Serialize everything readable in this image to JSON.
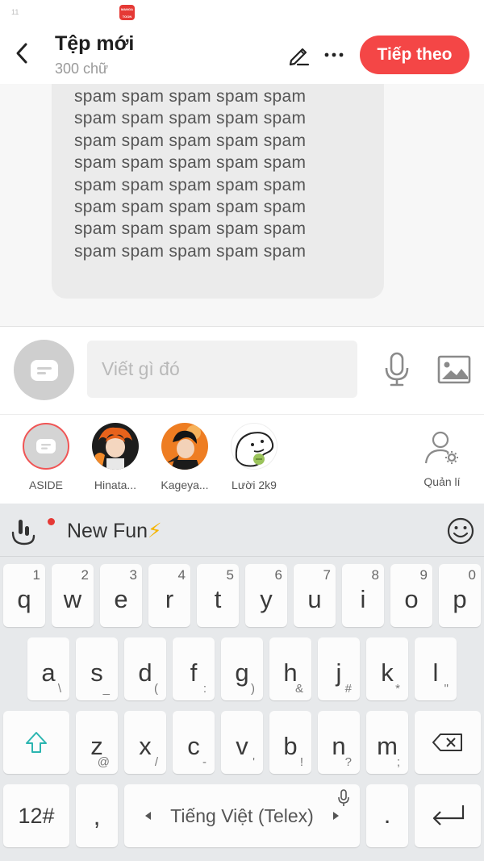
{
  "status_bar": {
    "left_text": "11",
    "app_logo_text": "MANGA TOON"
  },
  "header": {
    "title": "Tệp mới",
    "subtitle": "300 chữ",
    "next_button": "Tiếp theo"
  },
  "message": {
    "text": "spam spam spam spam spam spam spam spam spam spam spam spam spam spam spam spam spam spam spam spam spam spam spam spam spam spam spam spam spam spam spam spam spam spam spam spam spam spam spam spam"
  },
  "compose": {
    "placeholder": "Viết gì đó"
  },
  "characters": [
    {
      "name": "ASIDE"
    },
    {
      "name": "Hinata..."
    },
    {
      "name": "Kageya..."
    },
    {
      "name": "Lười 2k9"
    }
  ],
  "manage_label": "Quản lí",
  "keyboard": {
    "banner_text": "New Fun",
    "banner_emoji": "⚡",
    "row1": [
      {
        "k": "q",
        "h": "1"
      },
      {
        "k": "w",
        "h": "2"
      },
      {
        "k": "e",
        "h": "3"
      },
      {
        "k": "r",
        "h": "4"
      },
      {
        "k": "t",
        "h": "5"
      },
      {
        "k": "y",
        "h": "6"
      },
      {
        "k": "u",
        "h": "7"
      },
      {
        "k": "i",
        "h": "8"
      },
      {
        "k": "o",
        "h": "9"
      },
      {
        "k": "p",
        "h": "0"
      }
    ],
    "row2": [
      {
        "k": "a",
        "s": "\\"
      },
      {
        "k": "s",
        "s": "_"
      },
      {
        "k": "d",
        "s": "("
      },
      {
        "k": "f",
        "s": ":"
      },
      {
        "k": "g",
        "s": ")"
      },
      {
        "k": "h",
        "s": "&"
      },
      {
        "k": "j",
        "s": "#"
      },
      {
        "k": "k",
        "s": "*"
      },
      {
        "k": "l",
        "s": "\""
      }
    ],
    "row3": [
      {
        "k": "z",
        "s": "@"
      },
      {
        "k": "x",
        "s": "/"
      },
      {
        "k": "c",
        "s": "-"
      },
      {
        "k": "v",
        "s": "'"
      },
      {
        "k": "b",
        "s": "!"
      },
      {
        "k": "n",
        "s": "?"
      },
      {
        "k": "m",
        "s": ";"
      }
    ],
    "symbols_key": "12#",
    "comma_key": ",",
    "space_label": "Tiếng Việt (Telex)",
    "period_key": "."
  },
  "colors": {
    "accent": "#f44646",
    "keyboard_bg": "#e7e9eb",
    "shift_icon": "#2bb5b0"
  }
}
